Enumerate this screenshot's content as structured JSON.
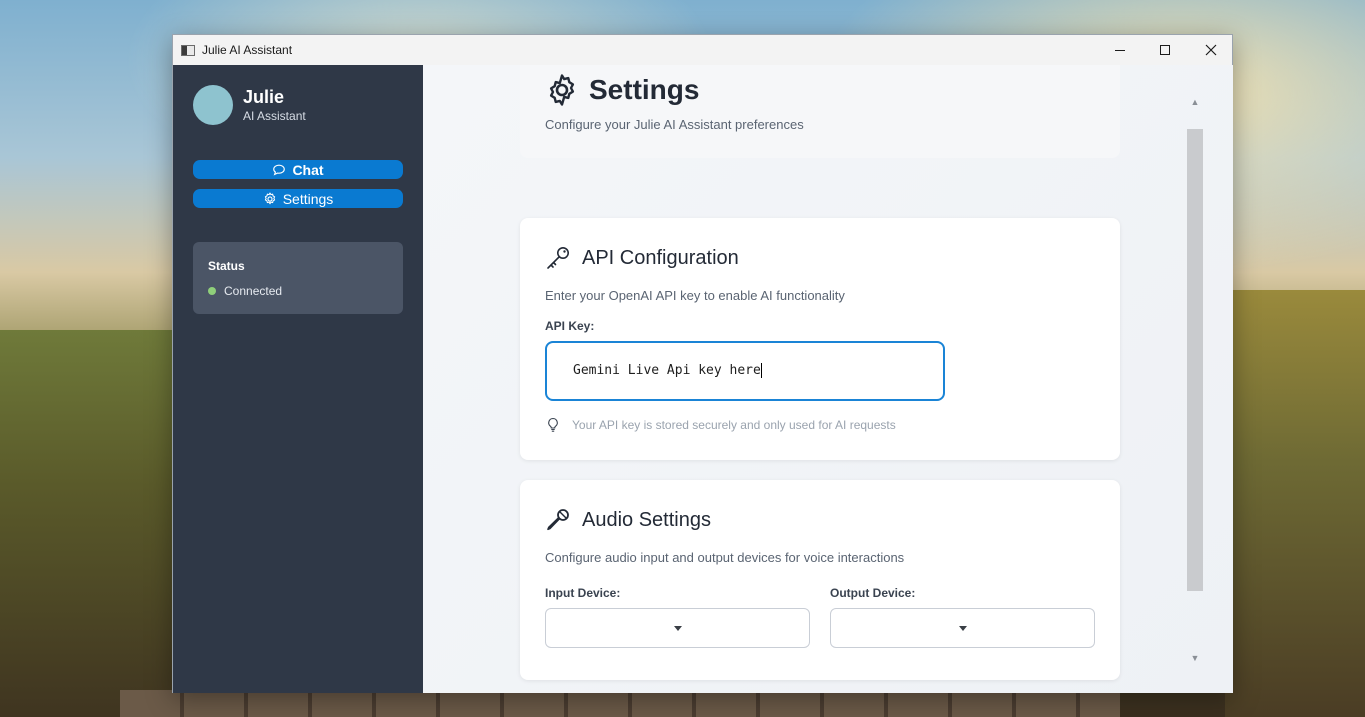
{
  "window": {
    "title": "Julie AI Assistant"
  },
  "sidebar": {
    "brand_name": "Julie",
    "brand_subtitle": "AI Assistant",
    "nav": {
      "chat_label": "Chat",
      "settings_label": "Settings"
    },
    "status": {
      "title": "Status",
      "value": "Connected",
      "dot_color": "#8fcf7a"
    }
  },
  "header": {
    "title": "Settings",
    "subtitle": "Configure your Julie AI Assistant preferences"
  },
  "api_config": {
    "title": "API Configuration",
    "description": "Enter your OpenAI API key to enable AI functionality",
    "field_label": "API Key:",
    "input_value": "Gemini Live Api key here",
    "hint": "Your API key is stored securely and only used for AI requests"
  },
  "audio_settings": {
    "title": "Audio Settings",
    "description": "Configure audio input and output devices for voice interactions",
    "input_label": "Input Device:",
    "output_label": "Output Device:",
    "input_value": "",
    "output_value": ""
  },
  "colors": {
    "accent": "#0a7ad1",
    "sidebar_bg": "#2f3847"
  },
  "icons": {
    "chat": "chat-bubble-icon",
    "settings": "gear-icon",
    "api": "key-icon",
    "audio": "microphone-icon",
    "hint": "lightbulb-icon"
  }
}
